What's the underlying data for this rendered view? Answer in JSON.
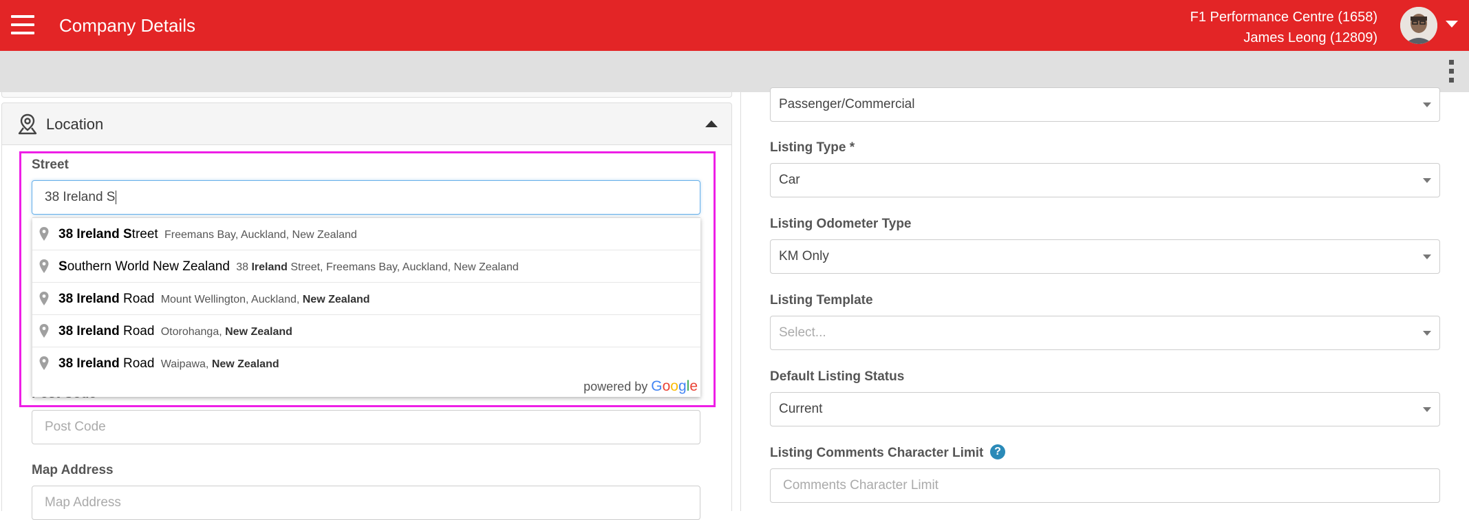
{
  "header": {
    "title": "Company Details",
    "company": "F1 Performance Centre (1658)",
    "user": "James Leong (12809)"
  },
  "location": {
    "section_title": "Location",
    "street_label": "Street",
    "street_value": "38 Ireland S",
    "suggestions": [
      {
        "main_bold": "38 Ireland S",
        "main_rest": "treet",
        "secondary": "Freemans Bay, Auckland, New Zealand",
        "sec_bold": ""
      },
      {
        "main_bold": "S",
        "main_rest": "outhern World New Zealand",
        "secondary_pre": "38 ",
        "secondary_bold": "Ireland",
        "secondary_post": " Street, Freemans Bay, Auckland, New Zealand"
      },
      {
        "main_bold": "38 Ireland",
        "main_rest": " Road",
        "secondary": "Mount Wellington, Auckland, ",
        "sec_bold": "New Zealand"
      },
      {
        "main_bold": "38 Ireland",
        "main_rest": " Road",
        "secondary": "Otorohanga, ",
        "sec_bold": "New Zealand"
      },
      {
        "main_bold": "38 Ireland",
        "main_rest": " Road",
        "secondary": "Waipawa, ",
        "sec_bold": "New Zealand"
      }
    ],
    "powered_by": "powered by",
    "google_letters": [
      "G",
      "o",
      "o",
      "g",
      "l",
      "e"
    ],
    "post_code_label": "Post Code",
    "post_code_placeholder": "Post Code",
    "map_address_label": "Map Address",
    "map_address_placeholder": "Map Address"
  },
  "right": {
    "top_select_value": "Passenger/Commercial",
    "listing_type_label": "Listing Type *",
    "listing_type_value": "Car",
    "odometer_label": "Listing Odometer Type",
    "odometer_value": "KM Only",
    "template_label": "Listing Template",
    "template_placeholder": "Select...",
    "status_label": "Default Listing Status",
    "status_value": "Current",
    "comments_label": "Listing Comments Character Limit",
    "comments_placeholder": "Comments Character Limit",
    "help_glyph": "?"
  },
  "colors": {
    "header_bg": "#e32526",
    "highlight": "#ee1ee6",
    "help_icon": "#2a8ab8"
  }
}
